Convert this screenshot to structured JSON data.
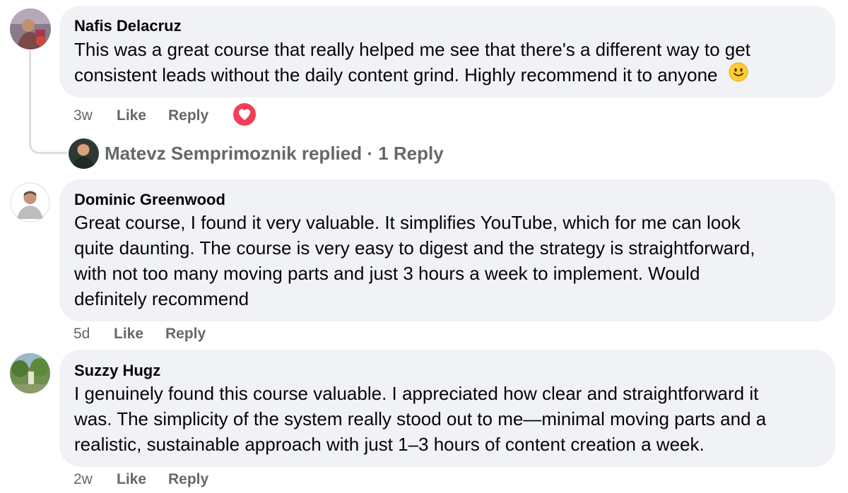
{
  "comments": [
    {
      "author": "Nafis Delacruz",
      "text_line1": "This was a great course that really helped me see that there's a different way to get",
      "text_line2": "consistent leads without the daily content grind. Highly recommend it to anyone",
      "time": "3w",
      "like_label": "Like",
      "reply_label": "Reply",
      "reaction": "love-reaction-icon",
      "replies_summary": {
        "text": "Matevz Semprimoznik replied · 1 Reply"
      }
    },
    {
      "author": "Dominic Greenwood",
      "text_lines": [
        "Great course, I found it very valuable. It simplifies YouTube, which for me can look",
        "quite daunting. The course is very easy to digest and the strategy is straightforward,",
        "with not too many moving parts and just 3 hours a week to implement. Would",
        "definitely recommend"
      ],
      "time": "5d",
      "like_label": "Like",
      "reply_label": "Reply"
    },
    {
      "author": "Suzzy Hugz",
      "text_lines": [
        "I genuinely found this course valuable. I appreciated how clear and straightforward it",
        "was. The simplicity of the system really stood out to me—minimal moving parts and a",
        "realistic, sustainable approach with just 1–3 hours of content creation a week."
      ],
      "time": "2w",
      "like_label": "Like",
      "reply_label": "Reply"
    }
  ],
  "colors": {
    "bubble": "#f0f2f5",
    "text": "#050505",
    "secondary": "#65676b",
    "love": "#f33e58"
  }
}
